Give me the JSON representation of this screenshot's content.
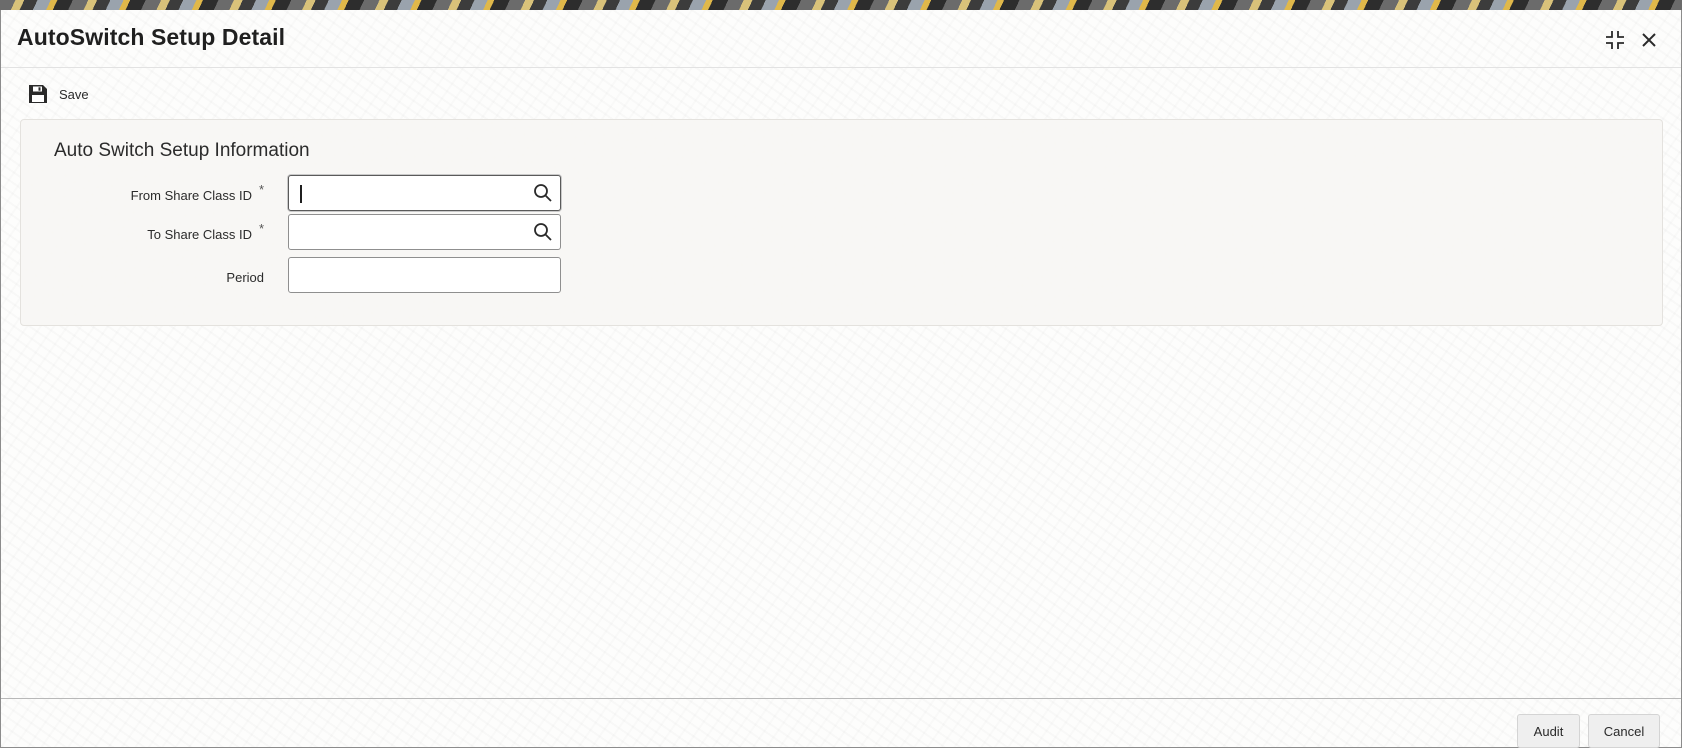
{
  "window": {
    "title": "AutoSwitch Setup Detail",
    "maximize_icon": "maximize-icon",
    "close_icon": "close-icon"
  },
  "toolbar": {
    "save_label": "Save",
    "save_icon": "floppy-disk-icon"
  },
  "section": {
    "title": "Auto Switch Setup Information"
  },
  "fields": {
    "from_share_class": {
      "label": "From Share Class ID",
      "required_marker": "*",
      "value": "",
      "icon": "search-icon"
    },
    "to_share_class": {
      "label": "To Share Class ID",
      "required_marker": "*",
      "value": "",
      "icon": "search-icon"
    },
    "period": {
      "label": "Period",
      "value": ""
    }
  },
  "footer": {
    "audit_label": "Audit",
    "cancel_label": "Cancel"
  }
}
